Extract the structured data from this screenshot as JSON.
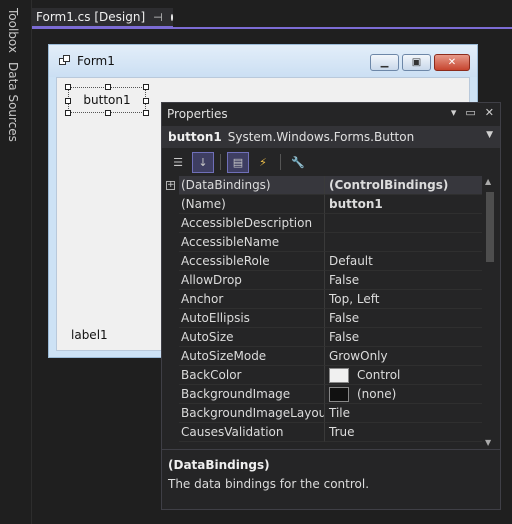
{
  "sidebar": {
    "tabs": [
      {
        "label": "Toolbox"
      },
      {
        "label": "Data Sources"
      }
    ]
  },
  "document_tab": {
    "title": "Form1.cs [Design]",
    "pin_icon": "pin-icon",
    "modified_icon": "dot-icon"
  },
  "form": {
    "title": "Form1",
    "button_label": "button1",
    "label_text": "label1"
  },
  "properties": {
    "panel_title": "Properties",
    "object_name": "button1",
    "object_type": "System.Windows.Forms.Button",
    "toolbar": [
      "categorized-icon",
      "alphabetical-icon",
      "properties-icon",
      "events-icon",
      "property-pages-icon"
    ],
    "rows": [
      {
        "name": "(DataBindings)",
        "value": "(ControlBindings)",
        "expandable": true,
        "bold_value": true,
        "selected": true
      },
      {
        "name": "(Name)",
        "value": "button1",
        "bold_value": true
      },
      {
        "name": "AccessibleDescription",
        "value": ""
      },
      {
        "name": "AccessibleName",
        "value": ""
      },
      {
        "name": "AccessibleRole",
        "value": "Default"
      },
      {
        "name": "AllowDrop",
        "value": "False"
      },
      {
        "name": "Anchor",
        "value": "Top, Left"
      },
      {
        "name": "AutoEllipsis",
        "value": "False"
      },
      {
        "name": "AutoSize",
        "value": "False"
      },
      {
        "name": "AutoSizeMode",
        "value": "GrowOnly"
      },
      {
        "name": "BackColor",
        "value": "Control",
        "swatch": "#f0f0f0"
      },
      {
        "name": "BackgroundImage",
        "value": "(none)",
        "swatch": "#111111"
      },
      {
        "name": "BackgroundImageLayout",
        "value": "Tile"
      },
      {
        "name": "CausesValidation",
        "value": "True"
      }
    ],
    "description": {
      "title": "(DataBindings)",
      "text": "The data bindings for the control."
    }
  },
  "colors": {
    "accent": "#7c6cd4",
    "ide_background": "#1f1f1f",
    "panel_background": "#252526"
  }
}
